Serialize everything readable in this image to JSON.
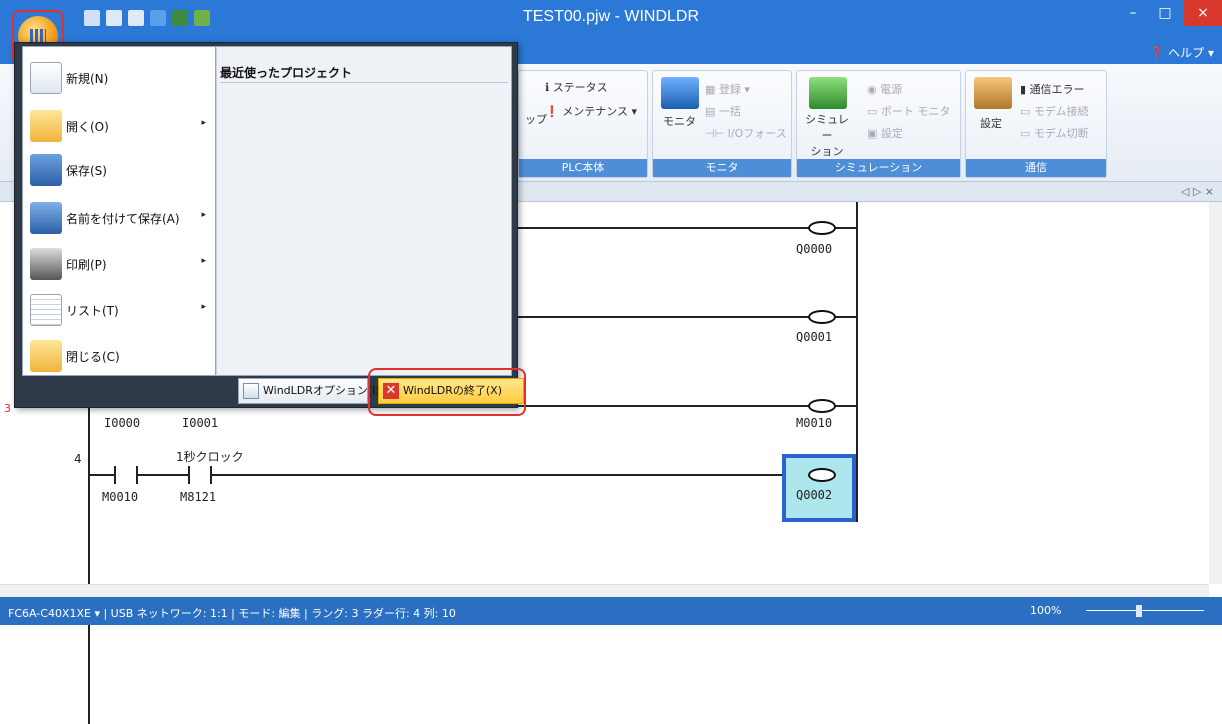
{
  "window": {
    "title": "TEST00.pjw - WINDLDR",
    "min": "–",
    "max": "□",
    "close": "×"
  },
  "help": {
    "label": "ヘルプ"
  },
  "ribbon": {
    "plc": {
      "label": "PLC本体",
      "status": "ステータス",
      "maint": "メンテナンス",
      "partial": "ップ"
    },
    "monitor": {
      "label": "モニタ",
      "big": "モニタ",
      "reg": "登録",
      "batch": "一括",
      "ioforce": "I/Oフォース"
    },
    "sim": {
      "label": "シミュレーション",
      "big": "シミュレー\nション",
      "power": "電源",
      "port": "ポート モニタ",
      "setting": "設定"
    },
    "comm": {
      "label": "通信",
      "big": "設定",
      "err": "通信エラー",
      "modem_conn": "モデム接続",
      "modem_cut": "モデム切断"
    }
  },
  "menu": {
    "recent_title": "最近使ったプロジェクト",
    "items": [
      {
        "label": "新規(N)",
        "icon": "new-document-icon",
        "arrow": ""
      },
      {
        "label": "開く(O)",
        "icon": "open-folder-icon",
        "arrow": "▸"
      },
      {
        "label": "保存(S)",
        "icon": "save-disk-icon",
        "arrow": ""
      },
      {
        "label": "名前を付けて保存(A)",
        "icon": "save-as-icon",
        "arrow": "▸"
      },
      {
        "label": "印刷(P)",
        "icon": "printer-icon",
        "arrow": "▸"
      },
      {
        "label": "リスト(T)",
        "icon": "list-icon",
        "arrow": "▸"
      },
      {
        "label": "閉じる(C)",
        "icon": "close-folder-icon",
        "arrow": ""
      }
    ],
    "options_btn": "WindLDRオプション(I)",
    "exit_btn": "WindLDRの終了(X)"
  },
  "ladder": {
    "coils": [
      "Q0000",
      "Q0001",
      "M0010",
      "Q0002"
    ],
    "contacts_row3": [
      "I0000",
      "I0001"
    ],
    "rung4": {
      "num": "4",
      "contacts": [
        "M0010",
        "M8121"
      ],
      "comment": "1秒クロック"
    },
    "marker": "3"
  },
  "docbar": {
    "nav": "◁ ▷ ×"
  },
  "status": {
    "text": "FC6A-C40X1XE  ▾ | USB  ネットワーク: 1:1 | モード: 編集  | ラング: 3  ラダー行: 4  列: 10",
    "zoom": "100%"
  },
  "colors": {
    "title": "#2b78d6",
    "accent": "#4d8ed6",
    "exit": "#ffcc40",
    "highlight": "#e03030"
  }
}
